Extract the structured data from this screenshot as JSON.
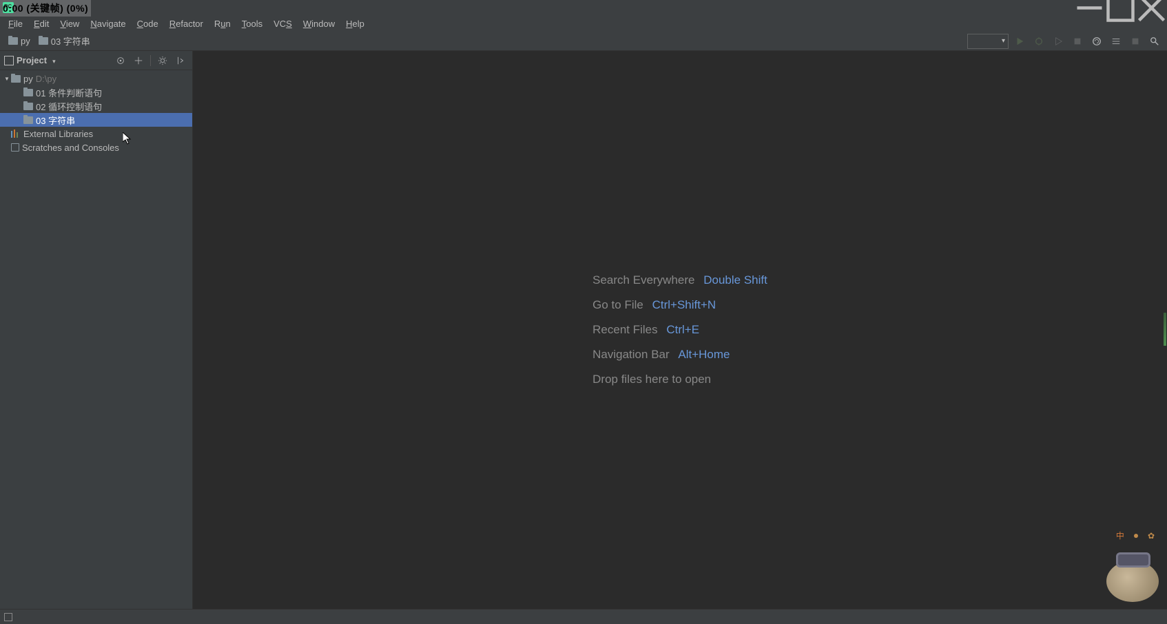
{
  "overlay_text": "0:00 (关键帧) (0%)",
  "menubar": {
    "file": "File",
    "edit": "Edit",
    "view": "View",
    "navigate": "Navigate",
    "code": "Code",
    "refactor": "Refactor",
    "run": "Run",
    "tools": "Tools",
    "vcs": "VCS",
    "window": "Window",
    "help": "Help"
  },
  "breadcrumbs": {
    "root": "py",
    "current": "03 字符串"
  },
  "sidebar": {
    "title": "Project",
    "project_name": "py",
    "project_path": "D:\\py",
    "folders": [
      {
        "label": "01 条件判断语句",
        "selected": false
      },
      {
        "label": "02 循环控制语句",
        "selected": false
      },
      {
        "label": "03 字符串",
        "selected": true
      }
    ],
    "external_libraries": "External Libraries",
    "scratches": "Scratches and Consoles"
  },
  "hints": {
    "search_label": "Search Everywhere",
    "search_kbd": "Double Shift",
    "goto_label": "Go to File",
    "goto_kbd": "Ctrl+Shift+N",
    "recent_label": "Recent Files",
    "recent_kbd": "Ctrl+E",
    "nav_label": "Navigation Bar",
    "nav_kbd": "Alt+Home",
    "drop_label": "Drop files here to open"
  },
  "ime": {
    "lang": "中"
  }
}
